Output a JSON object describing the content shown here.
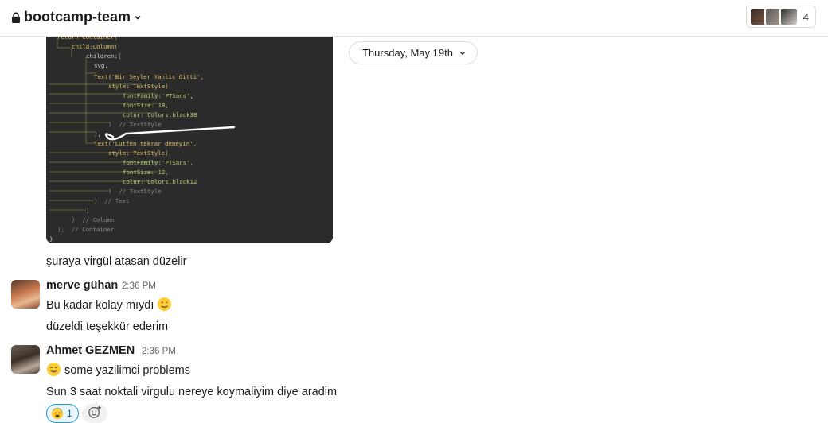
{
  "header": {
    "channel_name": "bootcamp-team",
    "member_count": "4"
  },
  "date_divider": {
    "label": "Thursday, May 19th"
  },
  "code_image": {
    "lines": [
      "return Container(",
      "  child:Column(",
      "     children:[",
      "      svg,",
      "      Text('Bir Seyler Yanlis Gitti',",
      "         style: TextStyle(",
      "            fontFamily:'PTSans',",
      "            fontSize: 18,",
      "            color: Colors.black38",
      "         )  // TextStyle",
      "      ),",
      "      Text('Lutfen tekrar deneyin',",
      "         style: TextStyle(",
      "            fontFamily:'PTSans',",
      "            fontSize: 12,",
      "            color: Colors.black12",
      "         )  // TextStyle",
      "      )  // Text",
      "     ]",
      "   )  // Column",
      " );  // Container",
      "}"
    ]
  },
  "messages": [
    {
      "id": "m0",
      "text": "şuraya virgül atasan düzelir"
    },
    {
      "id": "m1",
      "author": "merve gühan",
      "time": "2:36 PM",
      "lines": [
        "Bu kadar kolay mıydı",
        "düzeldi teşekkür ederim"
      ],
      "emoji": "smiling-face-with-tear"
    },
    {
      "id": "m2",
      "author": "Ahmet GEZMEN",
      "time": "2:36 PM",
      "lines": [
        "some yazilimci problems",
        "Sun 3 saat noktali virgulu nereye koymaliyim diye aradim"
      ],
      "emoji": "grinning-face",
      "reaction": {
        "emoji": "anxious-face-with-sweat",
        "count": "1"
      }
    }
  ],
  "colors": {
    "accent": "#1264a3",
    "code_bg": "#2b2b2b",
    "reaction_bg": "#e8f5fa"
  }
}
